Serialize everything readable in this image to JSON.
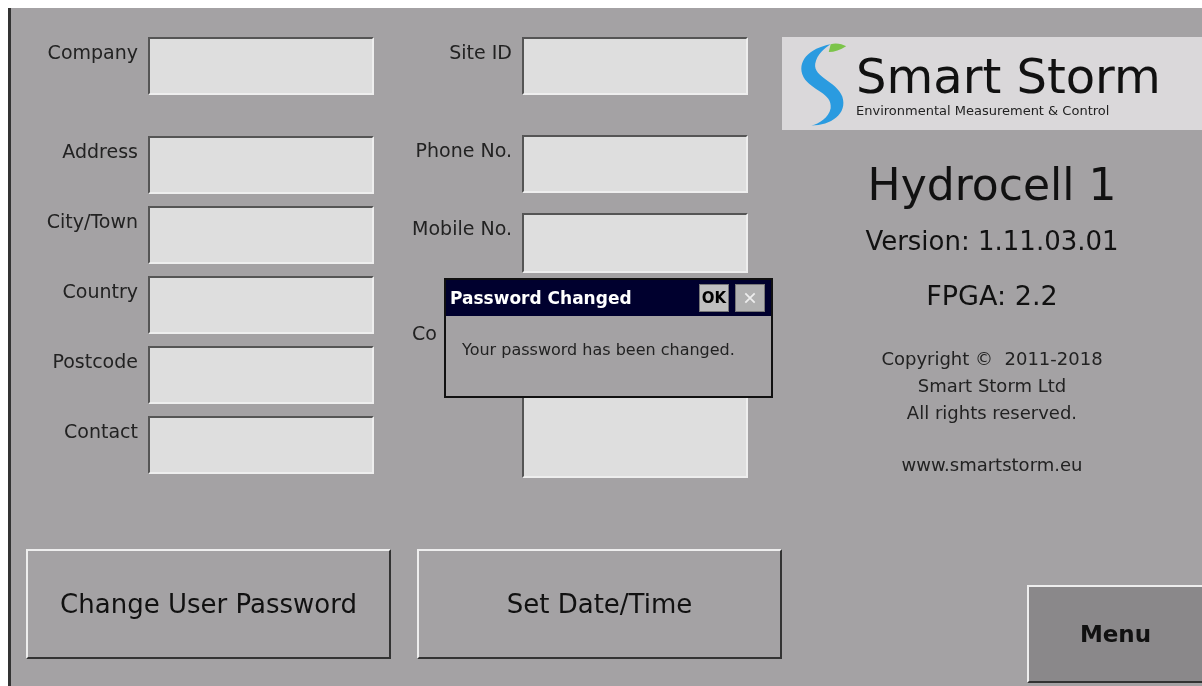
{
  "left_fields": [
    {
      "label": "Company"
    },
    {
      "label": "Address"
    },
    {
      "label": "City/Town"
    },
    {
      "label": "Country"
    },
    {
      "label": "Postcode"
    },
    {
      "label": "Contact"
    }
  ],
  "right_fields": [
    {
      "label": "Site ID"
    },
    {
      "label": "Phone No."
    },
    {
      "label": "Mobile No."
    },
    {
      "label": "Co"
    }
  ],
  "buttons": [
    "Change User Password",
    "Set Date/Time"
  ],
  "logo": {
    "name": "Smart Storm",
    "tagline": "Environmental Measurement & Control"
  },
  "product": {
    "title": "Hydrocell 1",
    "version": "Version: 1.11.03.01",
    "fpga": "FPGA: 2.2",
    "copyright": [
      "Copyright ©  2011-2018",
      "Smart Storm Ltd",
      "All rights reserved."
    ],
    "website": "www.smartstorm.eu"
  },
  "menu_button": "Menu",
  "dialog": {
    "title": "Password Changed",
    "ok": "OK",
    "close_disabled": true,
    "message": "Your password has been changed."
  }
}
